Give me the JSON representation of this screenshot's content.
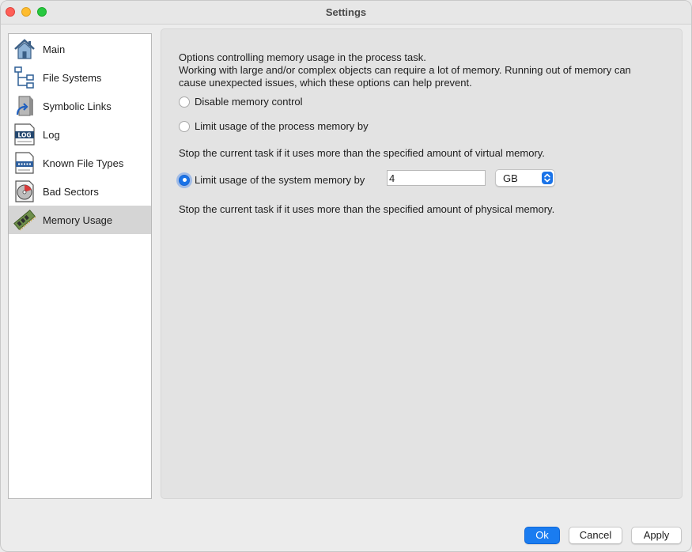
{
  "window": {
    "title": "Settings"
  },
  "sidebar": {
    "items": [
      {
        "label": "Main",
        "icon": "house-icon",
        "selected": false
      },
      {
        "label": "File Systems",
        "icon": "tree-icon",
        "selected": false
      },
      {
        "label": "Symbolic Links",
        "icon": "shortcut-icon",
        "selected": false
      },
      {
        "label": "Log",
        "icon": "log-icon",
        "selected": false
      },
      {
        "label": "Known File Types",
        "icon": "document-icon",
        "selected": false
      },
      {
        "label": "Bad Sectors",
        "icon": "disk-icon",
        "selected": false
      },
      {
        "label": "Memory Usage",
        "icon": "memory-chip-icon",
        "selected": true
      }
    ]
  },
  "panel": {
    "intro_line1": "Options controlling memory usage in the process task.",
    "intro_line2": "Working with large and/or complex objects can require a lot of memory. Running out of memory can",
    "intro_line3": "cause unexpected issues, which these options can help prevent.",
    "option_disable": "Disable memory control",
    "option_process": "Limit usage of the process memory by",
    "process_note": "Stop the current task if it uses more than the specified amount of virtual memory.",
    "option_system": "Limit usage of the system memory by",
    "system_value": "4",
    "system_unit": "GB",
    "system_note": "Stop the current task if it uses more than the specified amount of physical memory.",
    "selected_option": "system"
  },
  "buttons": {
    "ok": "Ok",
    "cancel": "Cancel",
    "apply": "Apply"
  },
  "colors": {
    "accent": "#1a7cf0",
    "selected_row": "#d5d5d5"
  }
}
